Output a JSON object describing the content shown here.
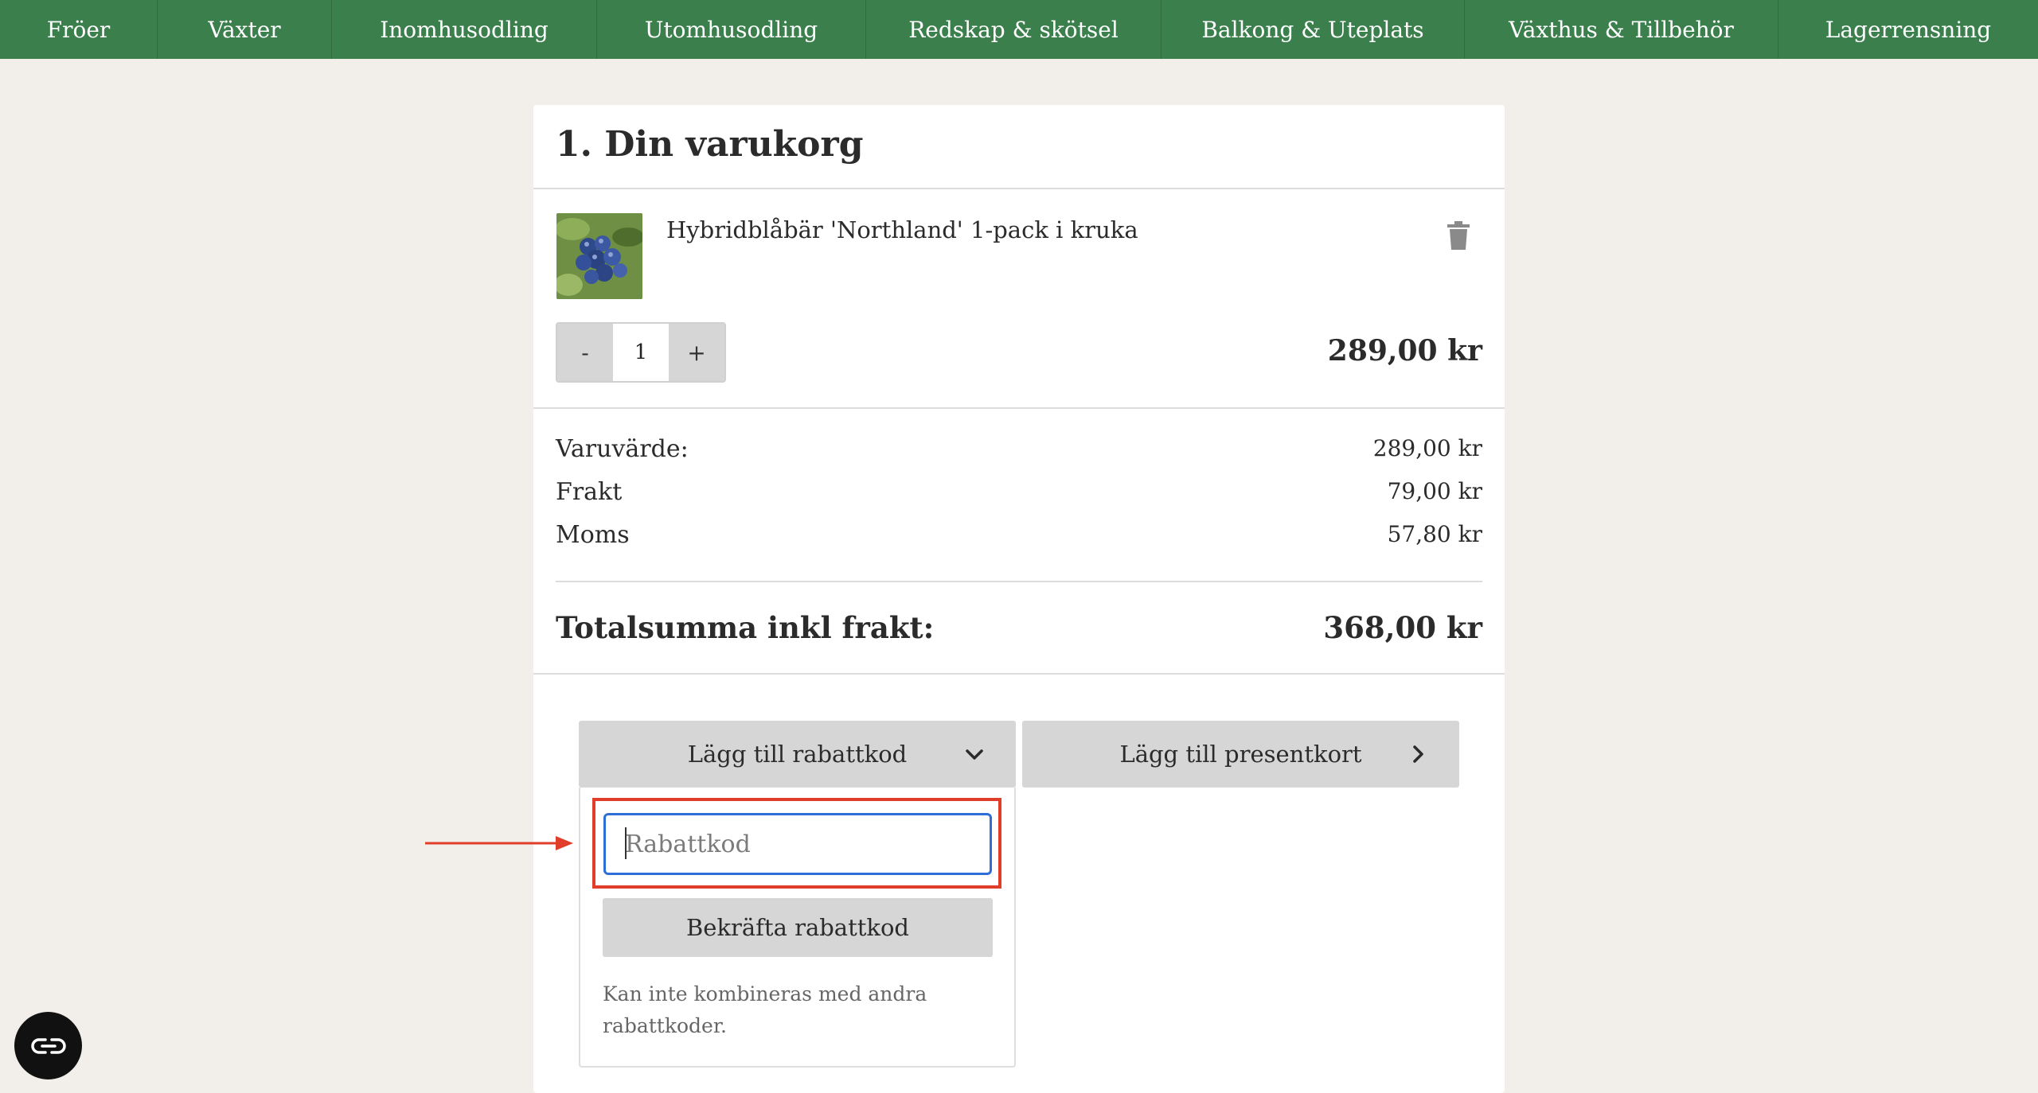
{
  "nav": {
    "items": [
      {
        "label": "Fröer"
      },
      {
        "label": "Växter"
      },
      {
        "label": "Inomhusodling"
      },
      {
        "label": "Utomhusodling"
      },
      {
        "label": "Redskap & skötsel"
      },
      {
        "label": "Balkong & Uteplats"
      },
      {
        "label": "Växthus & Tillbehör"
      },
      {
        "label": "Lagerrensning"
      }
    ]
  },
  "cart": {
    "title": "1. Din varukorg",
    "item": {
      "name": "Hybridblåbär 'Northland' 1-pack i kruka",
      "quantity": "1",
      "minus_label": "-",
      "plus_label": "+",
      "price": "289,00 kr",
      "image_icon": "blueberry-product-image"
    },
    "summary": {
      "goods_label": "Varuvärde:",
      "goods_value": "289,00 kr",
      "shipping_label": "Frakt",
      "shipping_value": "79,00 kr",
      "vat_label": "Moms",
      "vat_value": "57,80 kr"
    },
    "total": {
      "label": "Totalsumma inkl frakt:",
      "value": "368,00 kr"
    }
  },
  "discount": {
    "toggle_label": "Lägg till rabattkod",
    "input_placeholder": "Rabattkod",
    "confirm_label": "Bekräfta rabattkod",
    "note": "Kan inte kombineras med andra rabattkoder."
  },
  "giftcard": {
    "toggle_label": "Lägg till presentkort"
  },
  "colors": {
    "nav_bg": "#3a7f4c",
    "page_bg": "#f2efea",
    "highlight": "#e03d2b",
    "input_focus": "#2d6fd6"
  }
}
